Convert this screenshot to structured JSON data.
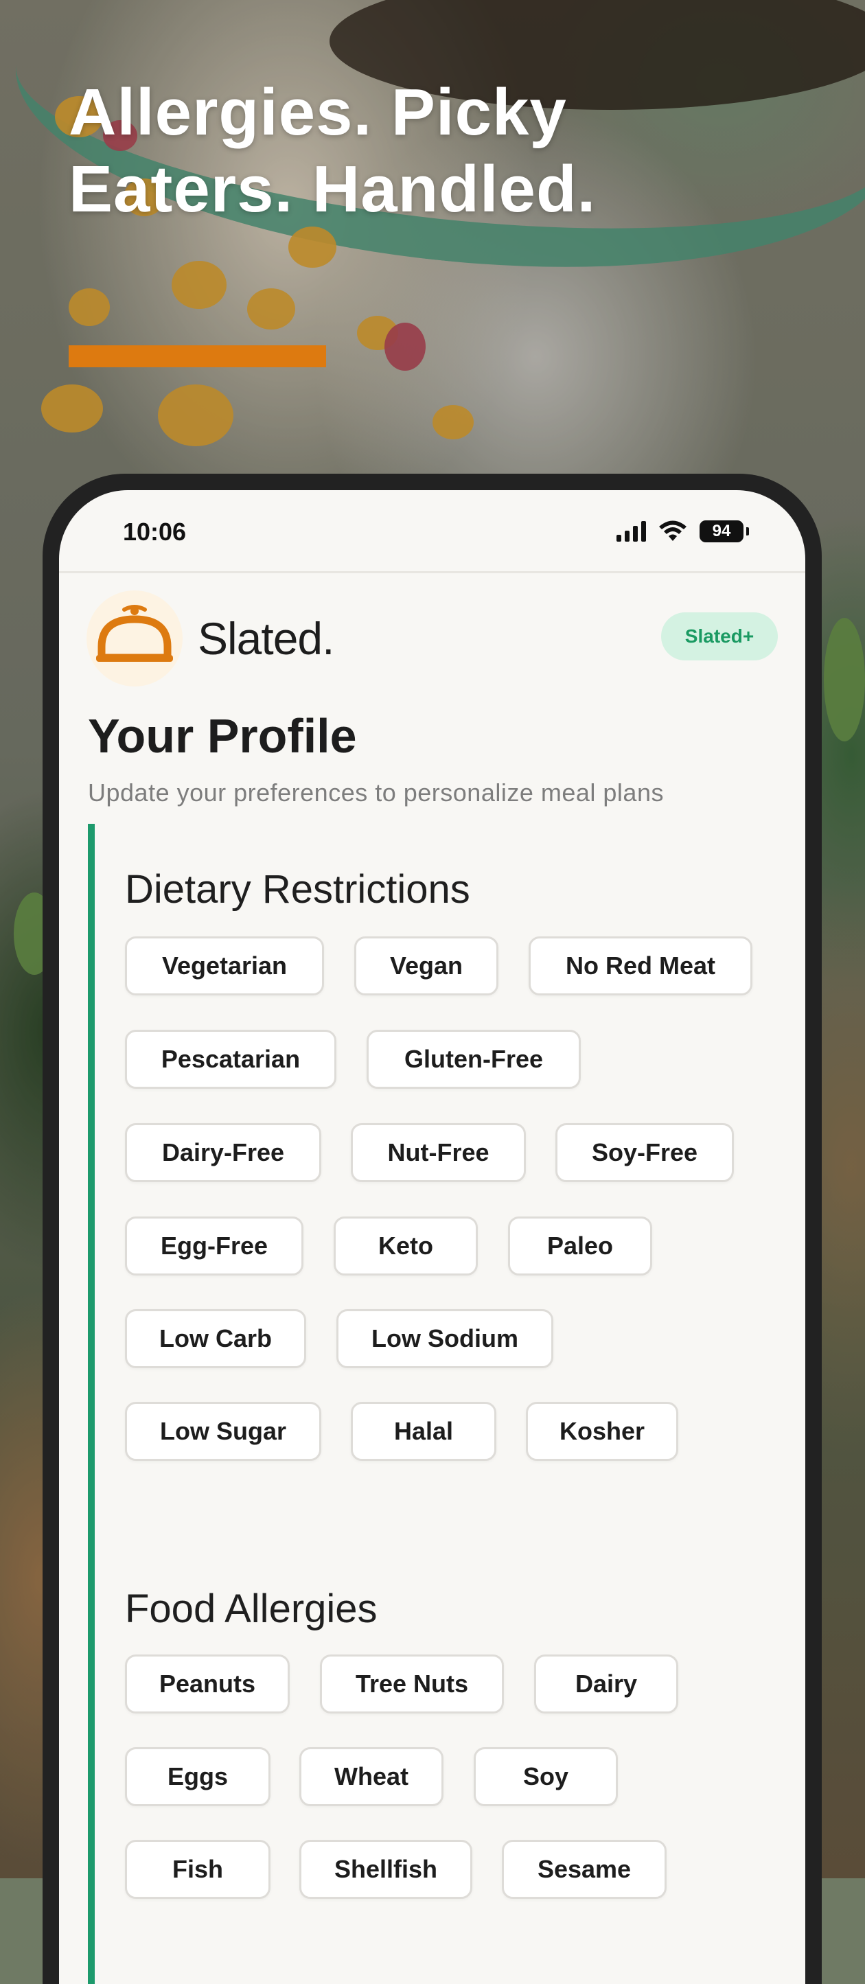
{
  "marketing": {
    "headline_line1": "Allergies. Picky",
    "headline_line2": "Eaters. Handled.",
    "accent_color": "#dd7a10"
  },
  "status_bar": {
    "time": "10:06",
    "battery": "94"
  },
  "app": {
    "name": "Slated.",
    "logo_icon": "cloche-icon",
    "plan_badge": "Slated+",
    "brand_color": "#dd7a10",
    "accent_green": "#1d9a6c"
  },
  "profile": {
    "title": "Your Profile",
    "subtitle": "Update your preferences to personalize meal plans"
  },
  "dietary": {
    "title": "Dietary Restrictions",
    "options": [
      "Vegetarian",
      "Vegan",
      "No Red Meat",
      "Pescatarian",
      "Gluten-Free",
      "Dairy-Free",
      "Nut-Free",
      "Soy-Free",
      "Egg-Free",
      "Keto",
      "Paleo",
      "Low Carb",
      "Low Sodium",
      "Low Sugar",
      "Halal",
      "Kosher"
    ]
  },
  "allergies": {
    "title": "Food Allergies",
    "options": [
      "Peanuts",
      "Tree Nuts",
      "Dairy",
      "Eggs",
      "Wheat",
      "Soy",
      "Fish",
      "Shellfish",
      "Sesame"
    ]
  }
}
